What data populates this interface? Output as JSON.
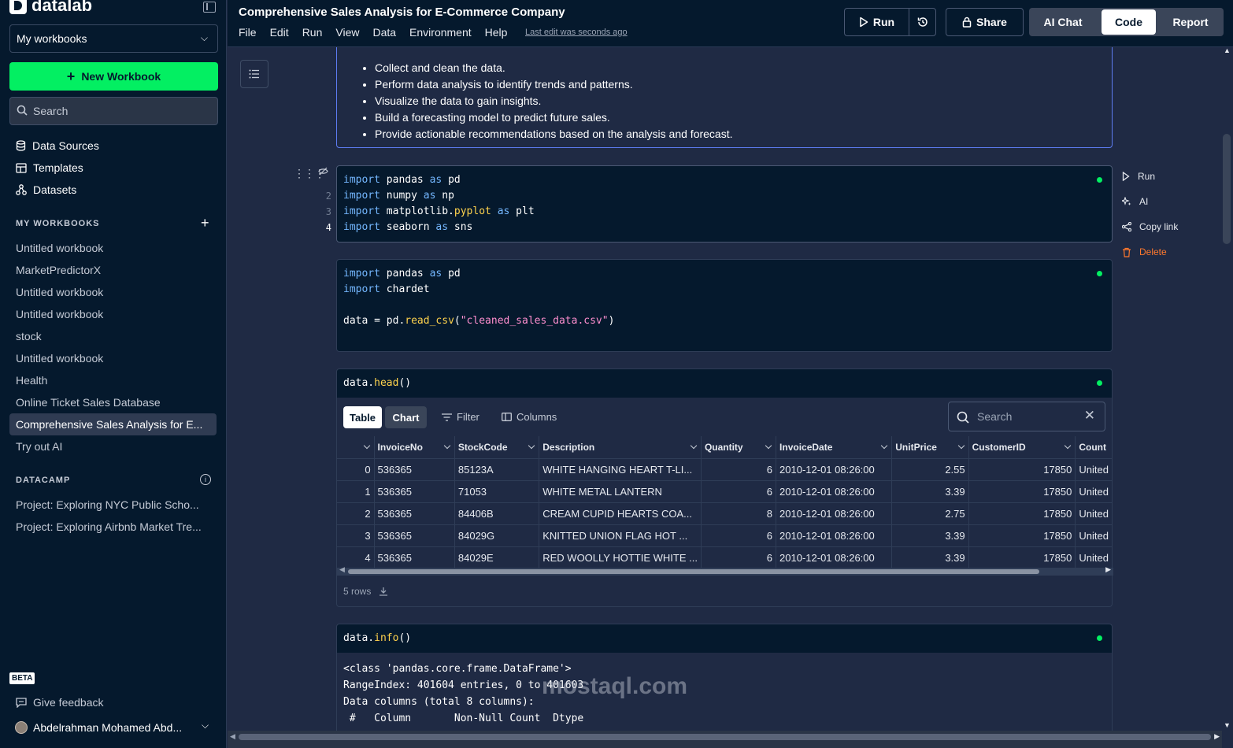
{
  "sidebar": {
    "logo": "datalab",
    "workspace": "My workbooks",
    "new_workbook": "New Workbook",
    "search_placeholder": "Search",
    "nav": [
      "Data Sources",
      "Templates",
      "Datasets"
    ],
    "my_workbooks_header": "MY WORKBOOKS",
    "workbooks": [
      "Untitled workbook",
      "MarketPredictorX",
      "Untitled workbook",
      "Untitled workbook",
      "stock",
      "Untitled workbook",
      "Health",
      "Online Ticket Sales Database",
      "Comprehensive Sales Analysis for E...",
      "Try out AI"
    ],
    "datacamp_header": "DATACAMP",
    "datacamp_items": [
      "Project: Exploring NYC Public Scho...",
      "Project: Exploring Airbnb Market Tre..."
    ],
    "beta_badge": "BETA",
    "feedback": "Give feedback",
    "user": "Abdelrahman Mohamed Abd..."
  },
  "topbar": {
    "title": "Comprehensive Sales Analysis for E-Commerce Company",
    "menu": [
      "File",
      "Edit",
      "Run",
      "View",
      "Data",
      "Environment",
      "Help"
    ],
    "last_edit": "Last edit was seconds ago",
    "run": "Run",
    "share": "Share",
    "tabs": [
      "AI Chat",
      "Code",
      "Report"
    ],
    "active_tab": "Code"
  },
  "markdown": {
    "bullets": [
      "Collect and clean the data.",
      "Perform data analysis to identify trends and patterns.",
      "Visualize the data to gain insights.",
      "Build a forecasting model to predict future sales.",
      "Provide actionable recommendations based on the analysis and forecast."
    ]
  },
  "cells": {
    "cell1_lines": [
      "2",
      "3",
      "4"
    ],
    "cell3_code": "data.head()",
    "cell4_code": "data.info()"
  },
  "cell_actions": [
    "Run",
    "AI",
    "Copy link",
    "Delete"
  ],
  "table_view": {
    "table_tab": "Table",
    "chart_tab": "Chart",
    "filter": "Filter",
    "columns": "Columns",
    "search_placeholder": "Search",
    "headers": [
      "",
      "InvoiceNo",
      "StockCode",
      "Description",
      "Quantity",
      "InvoiceDate",
      "UnitPrice",
      "CustomerID",
      "Count"
    ],
    "rows": [
      [
        "0",
        "536365",
        "85123A",
        "WHITE HANGING HEART T-LI...",
        "6",
        "2010-12-01 08:26:00",
        "2.55",
        "17850",
        "United"
      ],
      [
        "1",
        "536365",
        "71053",
        "WHITE METAL LANTERN",
        "6",
        "2010-12-01 08:26:00",
        "3.39",
        "17850",
        "United"
      ],
      [
        "2",
        "536365",
        "84406B",
        "CREAM CUPID HEARTS COA...",
        "8",
        "2010-12-01 08:26:00",
        "2.75",
        "17850",
        "United"
      ],
      [
        "3",
        "536365",
        "84029G",
        "KNITTED UNION FLAG HOT ...",
        "6",
        "2010-12-01 08:26:00",
        "3.39",
        "17850",
        "United"
      ],
      [
        "4",
        "536365",
        "84029E",
        "RED WOOLLY HOTTIE WHITE ...",
        "6",
        "2010-12-01 08:26:00",
        "3.39",
        "17850",
        "United"
      ]
    ],
    "row_count": "5 rows"
  },
  "info_output": [
    "<class 'pandas.core.frame.DataFrame'>",
    "RangeIndex: 401604 entries, 0 to 401603",
    "Data columns (total 8 columns):",
    " #   Column       Non-Null Count  Dtype"
  ],
  "watermark": "mostaql.com"
}
